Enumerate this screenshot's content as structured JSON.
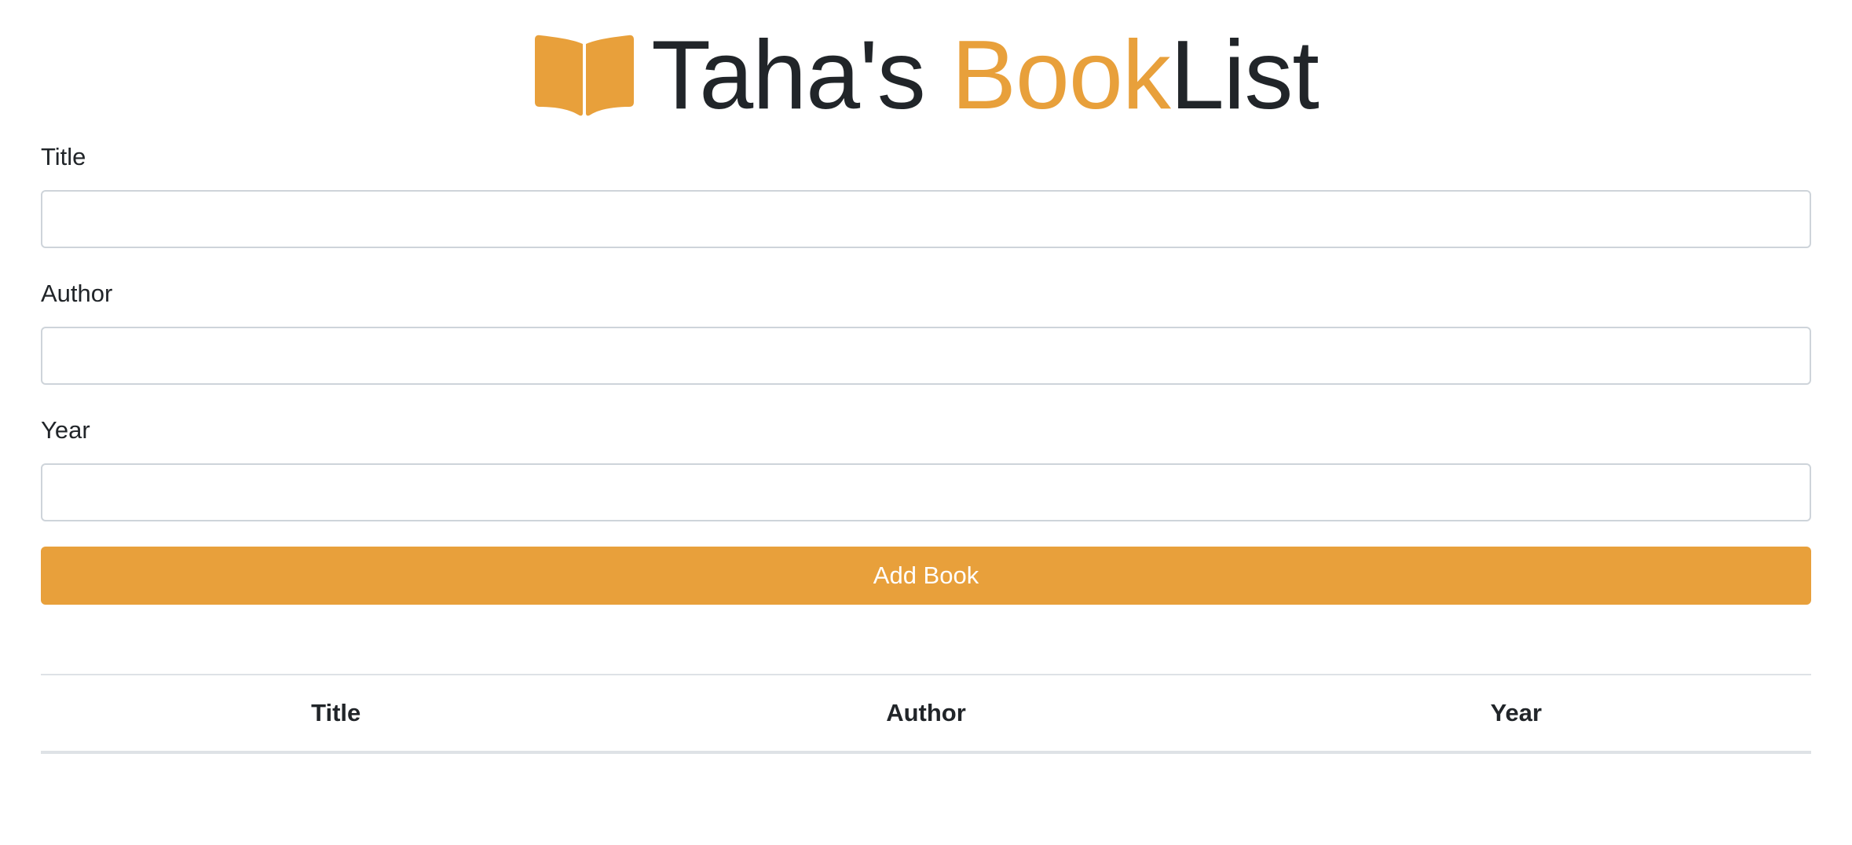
{
  "header": {
    "icon": "open-book-icon",
    "title_part1": "Taha's ",
    "title_part2": "Book",
    "title_part3": "List"
  },
  "form": {
    "title_label": "Title",
    "title_value": "",
    "author_label": "Author",
    "author_value": "",
    "year_label": "Year",
    "year_value": "",
    "submit_label": "Add Book"
  },
  "table": {
    "columns": [
      "Title",
      "Author",
      "Year"
    ],
    "rows": []
  },
  "colors": {
    "accent": "#e8a03b",
    "text": "#212529",
    "border": "#ced4da"
  }
}
